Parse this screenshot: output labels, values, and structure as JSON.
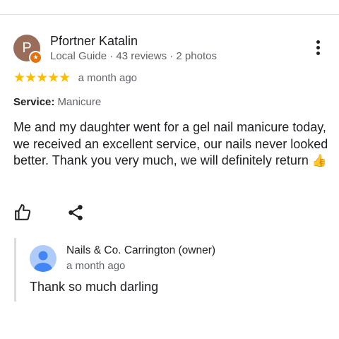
{
  "review": {
    "avatar_initial": "P",
    "badge_glyph": "★",
    "reviewer_name": "Pfortner Katalin",
    "reviewer_meta": "Local Guide · 43 reviews · 2 photos",
    "rating": 5,
    "stars": "★★★★★",
    "date": "a month ago",
    "service_label": "Service:",
    "service_value": "Manicure",
    "text": "Me and my daughter went for a gel nail manicure today, we received an excellent service, our nails never looked better. Thank you very much, we will definitely return",
    "emoji": "👍"
  },
  "owner_reply": {
    "name": "Nails & Co. Carrington (owner)",
    "date": "a month ago",
    "text": "Thank so much darling"
  },
  "icons": {
    "more": "more-vert-icon",
    "like": "thumb-up-icon",
    "share": "share-icon",
    "badge": "local-guide-badge-icon",
    "owner_avatar": "person-icon"
  },
  "colors": {
    "star": "#fbbc04",
    "avatar": "#9a6d5a",
    "badge": "#e8710a",
    "owner_avatar": "#4285f4"
  }
}
